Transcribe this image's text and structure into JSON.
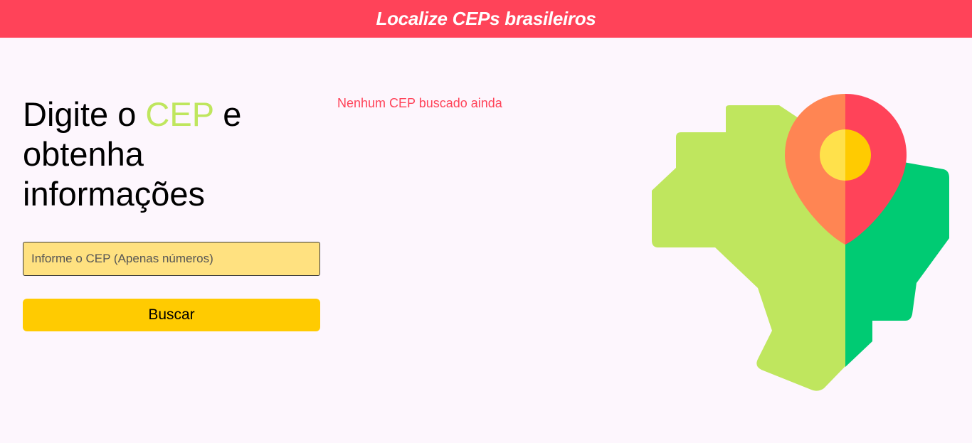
{
  "header": {
    "title": "Localize CEPs brasileiros"
  },
  "main": {
    "headline": {
      "before": "Digite o ",
      "highlight": "CEP",
      "after": " e obtenha informações"
    },
    "cep_input": {
      "placeholder": "Informe o CEP (Apenas números)",
      "value": ""
    },
    "search_button_label": "Buscar",
    "result_status": "Nenhum CEP buscado ainda"
  },
  "colors": {
    "header_bg": "#ff4359",
    "accent_green": "#bfe65e",
    "input_bg": "#ffe180",
    "button_bg": "#ffcb01",
    "status_text": "#ff4359",
    "map_green_dark": "#00cb73",
    "pin_orange": "#ff8553",
    "pin_red": "#ff4359"
  },
  "illustration": {
    "icon": "brazil-map-location-pin-icon"
  }
}
